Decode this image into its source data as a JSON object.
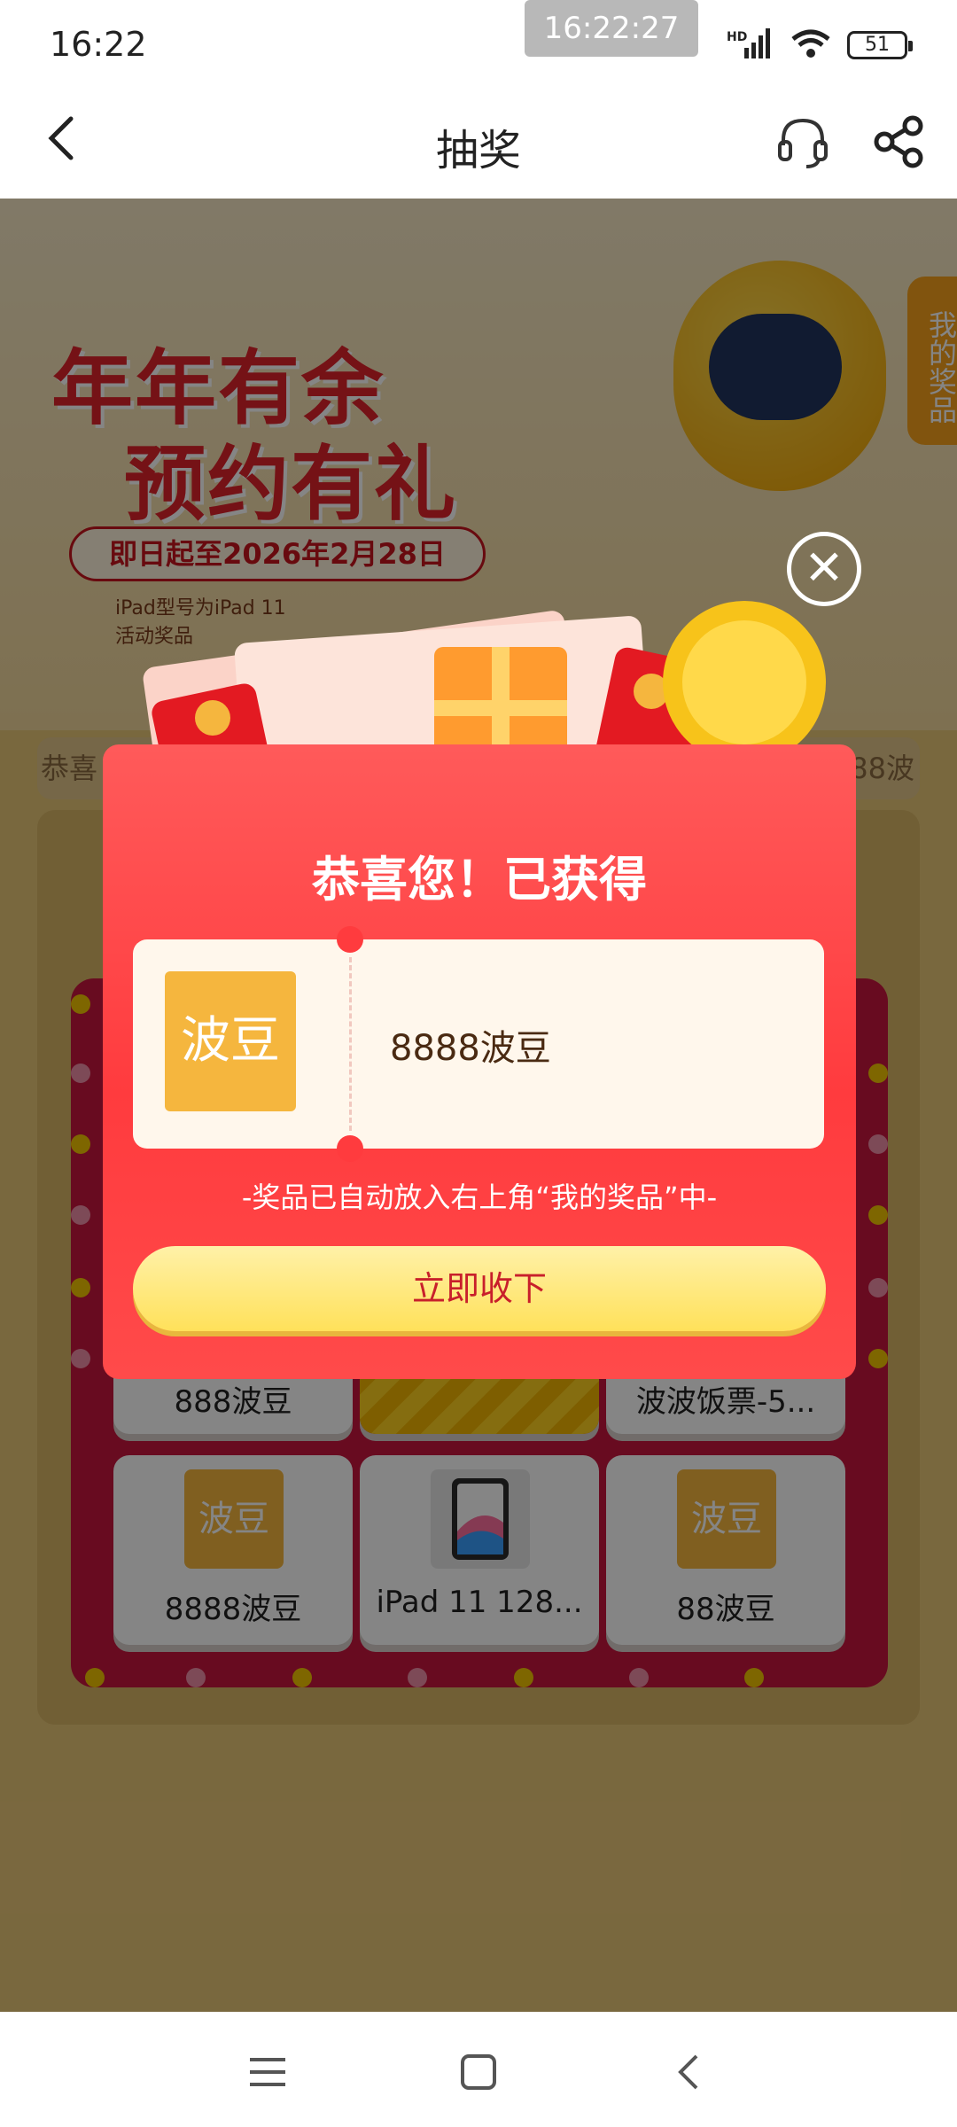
{
  "status": {
    "time": "16:22",
    "center_time": "16:22:27",
    "network": "HD",
    "battery": "51"
  },
  "nav": {
    "title": "抽奖"
  },
  "banner": {
    "title_line1": "年年有余",
    "title_line2": "预约有礼",
    "dates": "即日起至2026年2月28日",
    "note1": "iPad型号为iPad 11",
    "note2": "活动奖品"
  },
  "side_button": "我的奖品",
  "marquee": "恭喜",
  "marquee_right": "888波",
  "grid": {
    "row_mid": [
      {
        "label": "888波豆"
      },
      {
        "label": ""
      },
      {
        "label": "波波饭票-5..."
      }
    ],
    "row_bottom": [
      {
        "icon_text": "波豆",
        "label": "8888波豆"
      },
      {
        "icon_text": "",
        "label": "iPad 11 128..."
      },
      {
        "icon_text": "波豆",
        "label": "88波豆"
      }
    ]
  },
  "modal": {
    "heading": "恭喜您！已获得",
    "prize_icon": "波豆",
    "prize_name": "8888波豆",
    "hint": "-奖品已自动放入右上角“我的奖品”中-",
    "cta": "立即收下"
  },
  "icons": {
    "back": "chevron-left-icon",
    "customer_service": "headset-icon",
    "share": "share-icon",
    "close": "close-icon",
    "menu": "menu-icon",
    "home": "home-square-icon",
    "back_nav": "back-triangle-icon"
  },
  "colors": {
    "accent": "#ff3b3e",
    "brand_gold": "#f5b63e",
    "cta": "#ffe15a"
  }
}
